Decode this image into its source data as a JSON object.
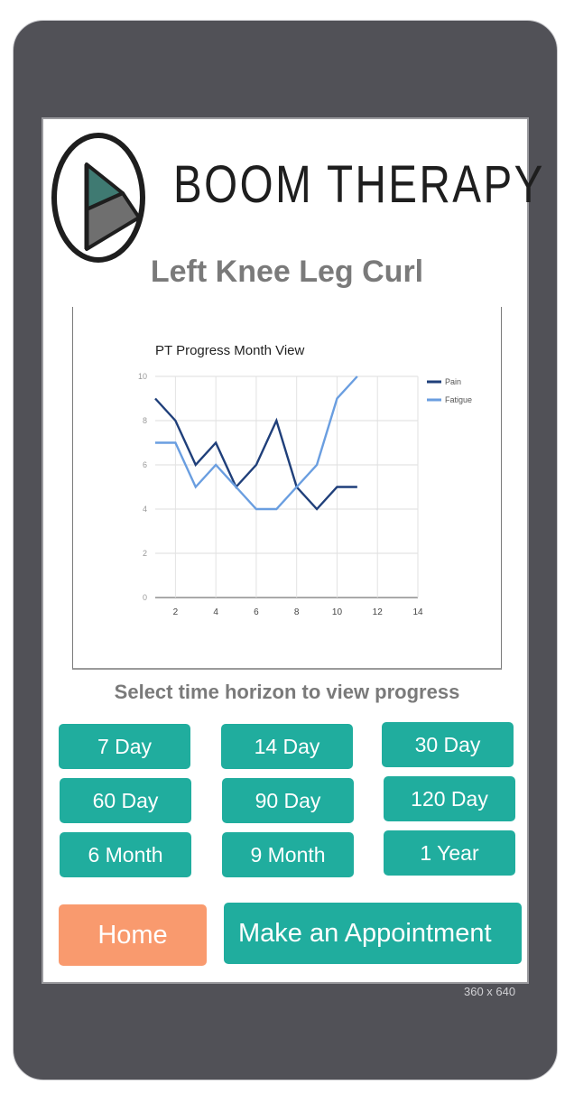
{
  "app": {
    "brand_name": "BOOM THERAPY",
    "title": "Left Knee Leg Curl",
    "viewport_label": "360 x 640"
  },
  "colors": {
    "frame": "#515157",
    "accent_teal": "#20ad9e",
    "home_orange": "#f99a6e",
    "title_gray": "#7a7a7a",
    "pain_line": "#1f3f7a",
    "fatigue_line": "#6a9ee0"
  },
  "chart_data": {
    "type": "line",
    "title": "PT Progress Month View",
    "xlabel": "",
    "ylabel": "",
    "xlim": [
      1,
      14
    ],
    "ylim": [
      0,
      10
    ],
    "x_ticks": [
      2,
      4,
      6,
      8,
      10,
      12,
      14
    ],
    "y_ticks": [
      0,
      2,
      4,
      6,
      8,
      10
    ],
    "grid": true,
    "legend_position": "right",
    "series": [
      {
        "name": "Pain",
        "color": "#1f3f7a",
        "x": [
          1,
          2,
          3,
          4,
          5,
          6,
          7,
          8,
          9,
          10,
          11
        ],
        "values": [
          9,
          8,
          6,
          7,
          5,
          6,
          8,
          5,
          4,
          5,
          5
        ]
      },
      {
        "name": "Fatigue",
        "color": "#6a9ee0",
        "x": [
          1,
          2,
          3,
          4,
          5,
          6,
          7,
          8,
          9,
          10,
          11
        ],
        "values": [
          7,
          7,
          5,
          6,
          5,
          4,
          4,
          5,
          6,
          9,
          10
        ]
      }
    ]
  },
  "section": {
    "prompt": "Select time horizon to view progress"
  },
  "horizons": [
    {
      "label": "7 Day"
    },
    {
      "label": "14 Day"
    },
    {
      "label": "30 Day"
    },
    {
      "label": "60 Day"
    },
    {
      "label": "90 Day"
    },
    {
      "label": "120 Day"
    },
    {
      "label": "6 Month"
    },
    {
      "label": "9 Month"
    },
    {
      "label": "1 Year"
    }
  ],
  "actions": {
    "home_label": "Home",
    "appointment_label": "Make an Appointment"
  }
}
